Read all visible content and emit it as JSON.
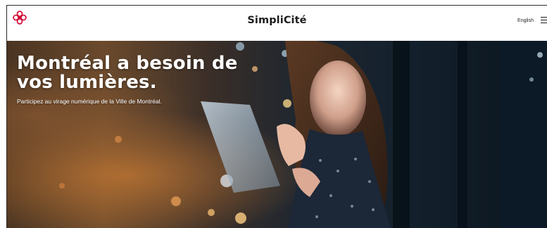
{
  "header": {
    "site_title": "SimpliCité",
    "language_link": "English",
    "logo_icon": "montreal-rosette-logo-icon",
    "menu_icon": "hamburger-menu-icon",
    "logo_color": "#d0002e"
  },
  "hero": {
    "title_line1": "Montréal a besoin de",
    "title_line2": "vos lumières.",
    "subtitle": "Participez au virage numérique de la Ville de Montréal.",
    "image_subject": "woman-using-tablet-at-night-photo"
  }
}
